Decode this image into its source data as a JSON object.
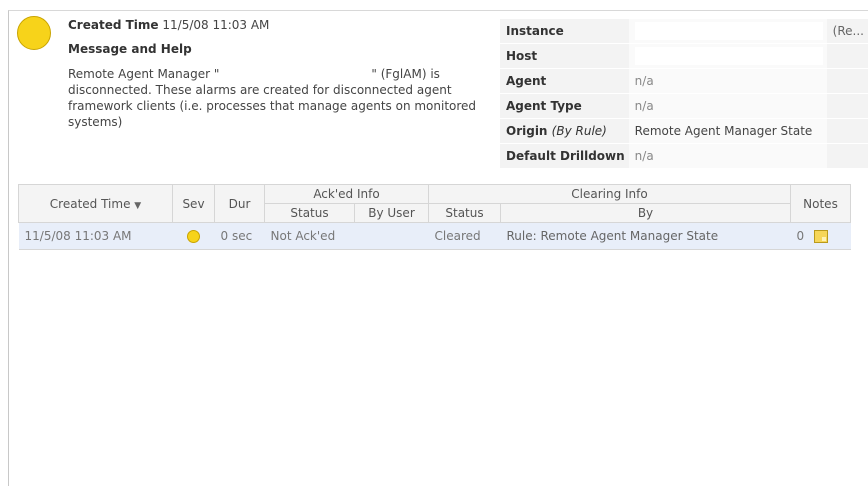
{
  "header": {
    "created_label": "Created Time",
    "created_value": "11/5/08 11:03 AM",
    "message_title": "Message and Help",
    "message_part1": "Remote Agent Manager \"",
    "message_part2": "\" (FglAM) is disconnected. These alarms are created for disconnected agent framework clients (i.e. processes that manage agents on monitored systems)"
  },
  "properties": {
    "instance_label": "Instance",
    "instance_extra": "(Re...",
    "host_label": "Host",
    "agent_label": "Agent",
    "agent_value": "n/a",
    "agent_type_label": "Agent Type",
    "agent_type_value": "n/a",
    "origin_label": "Origin",
    "origin_qualifier": "By Rule",
    "origin_value": "Remote Agent Manager State",
    "drilldown_label": "Default Drilldown",
    "drilldown_value": "n/a"
  },
  "grid": {
    "headers": {
      "created_time": "Created Time",
      "sev": "Sev",
      "dur": "Dur",
      "acked_info": "Ack'ed Info",
      "acked_status": "Status",
      "acked_by_user": "By User",
      "clearing_info": "Clearing Info",
      "clearing_status": "Status",
      "clearing_by": "By",
      "notes": "Notes"
    },
    "rows": [
      {
        "created_time": "11/5/08 11:03 AM",
        "dur": "0 sec",
        "ack_status": "Not Ack'ed",
        "ack_by_user": "",
        "clear_status": "Cleared",
        "clear_by": "Rule: Remote Agent Manager State",
        "notes_count": "0"
      }
    ]
  },
  "colors": {
    "severity": "#f7d31a",
    "row_selected": "#e8eef9"
  },
  "icons": {
    "severity": "warning-circle-icon",
    "notes": "note-icon",
    "sort": "sort-desc-icon"
  }
}
